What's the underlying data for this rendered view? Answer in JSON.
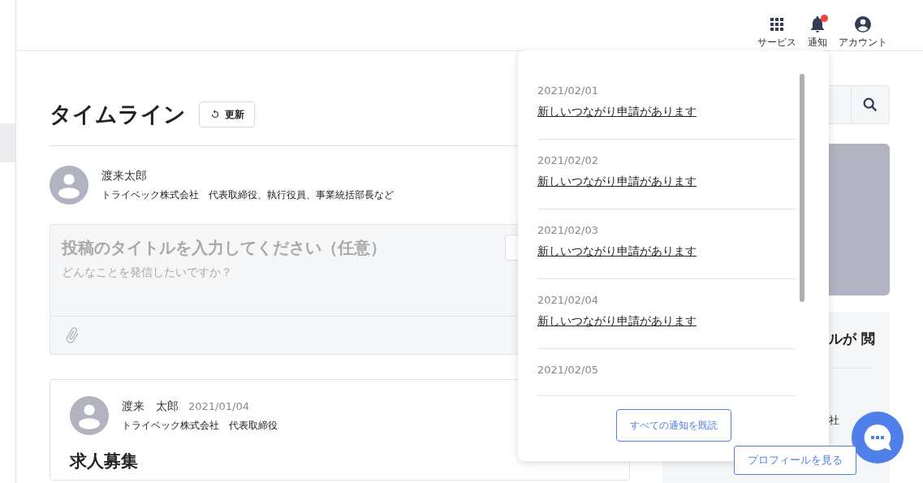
{
  "header": {
    "nav": [
      {
        "kind": "grid",
        "label": "サービス",
        "badge": false
      },
      {
        "kind": "bell",
        "label": "通知",
        "badge": true
      },
      {
        "kind": "account",
        "label": "アカウント",
        "badge": false
      }
    ]
  },
  "timeline": {
    "title": "タイムライン",
    "refresh_button": "更新",
    "user": {
      "name": "渡来太郎",
      "affiliation": "トライベック株式会社　代表取締役、執行役員、事業統括部長など"
    },
    "composer": {
      "title_placeholder": "投稿のタイトルを入力してください（任意）",
      "body_placeholder": "どんなことを発信したいですか？"
    },
    "posts": [
      {
        "author": "渡来　太郎",
        "date": "2021/01/04",
        "affiliation": "トライベック株式会社　代表取締役",
        "title": "求人募集"
      }
    ]
  },
  "right_panel": {
    "heading": "ルが 閲",
    "company": "社",
    "profile_button": "プロフィールを見る"
  },
  "notifications": {
    "items": [
      {
        "date": "2021/02/01",
        "message": "新しいつながり申請があります"
      },
      {
        "date": "2021/02/02",
        "message": "新しいつながり申請があります"
      },
      {
        "date": "2021/02/03",
        "message": "新しいつながり申請があります"
      },
      {
        "date": "2021/02/04",
        "message": "新しいつながり申請があります"
      },
      {
        "date": "2021/02/05"
      }
    ],
    "mark_all_button": "すべての通知を既読"
  }
}
